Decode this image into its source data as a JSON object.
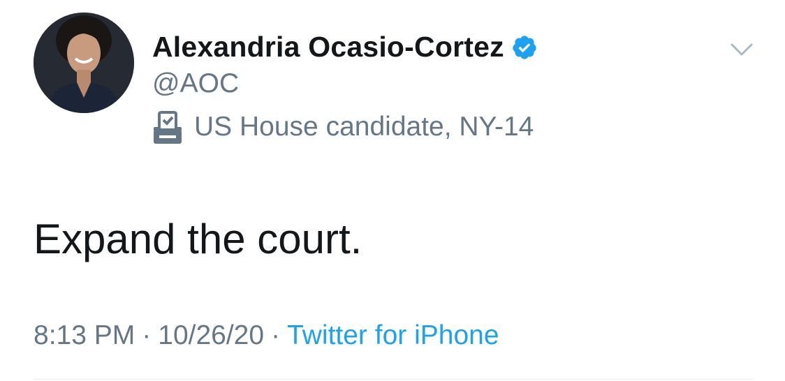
{
  "author": {
    "display_name": "Alexandria Ocasio-Cortez",
    "handle": "@AOC",
    "verified": true,
    "label": "US House candidate, NY-14",
    "label_icon": "ballot-box-icon"
  },
  "tweet": {
    "text": "Expand the court.",
    "time": "8:13 PM",
    "separator": "·",
    "date": "10/26/20",
    "source": "Twitter for iPhone"
  },
  "icons": {
    "caret": "chevron-down-icon",
    "verified": "verified-badge-icon"
  },
  "colors": {
    "name_text": "#14171a",
    "secondary_text": "#657786",
    "link_blue": "#1da1f2",
    "verified_blue": "#1da1f2",
    "background": "#ffffff",
    "divider": "#e6ecf0"
  }
}
